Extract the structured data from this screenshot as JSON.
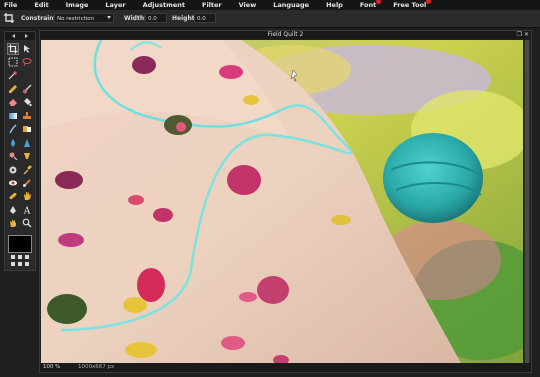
{
  "menu": [
    {
      "label": "File"
    },
    {
      "label": "Edit"
    },
    {
      "label": "Image"
    },
    {
      "label": "Layer"
    },
    {
      "label": "Adjustment"
    },
    {
      "label": "Filter"
    },
    {
      "label": "View"
    },
    {
      "label": "Language"
    },
    {
      "label": "Help"
    },
    {
      "label": "Font",
      "badge": true
    },
    {
      "label": "Free Tool",
      "badge": true
    }
  ],
  "options": {
    "constraint_label": "Constraint:",
    "constraint_value": "No restriction",
    "width_label": "Width:",
    "width_value": "0.0",
    "height_label": "Height:",
    "height_value": "0.0"
  },
  "document": {
    "title": "Field Quilt 2",
    "zoom": "100",
    "zoom_unit": "%",
    "dimensions": "1000x667 px"
  },
  "colors": {
    "foreground": "#000000",
    "accent": "#d22222"
  },
  "tools": [
    "crop-icon",
    "move-icon",
    "marquee-icon",
    "lasso-icon",
    "magic-wand-icon",
    "pencil-icon",
    "brush-icon",
    "eraser-icon",
    "bucket-icon",
    "stamp-icon",
    "gradient-icon",
    "smudge-icon",
    "blur-icon",
    "sharpen-icon",
    "dodge-icon",
    "burn-icon",
    "sponge-icon",
    "eyedropper-icon",
    "red-eye-icon",
    "color-replace-icon",
    "clone-icon",
    "heal-icon",
    "pen-icon",
    "type-icon",
    "hand-icon",
    "zoom-icon"
  ]
}
